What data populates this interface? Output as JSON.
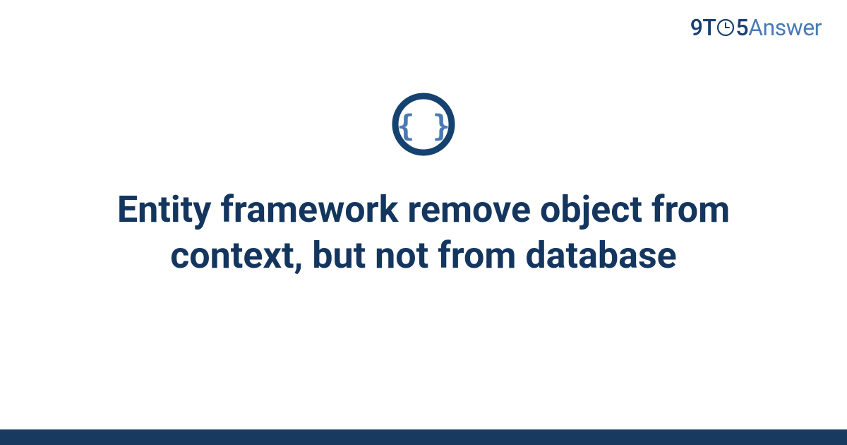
{
  "brand": {
    "prefix": "9T",
    "mid": "5",
    "suffix": "Answer"
  },
  "icon": {
    "name": "braces-icon",
    "ring_color": "#15426f",
    "brace_color": "#4a7ab5"
  },
  "title": "Entity framework remove object from context, but not from database",
  "colors": {
    "title": "#14365e",
    "footer": "#183a60"
  }
}
